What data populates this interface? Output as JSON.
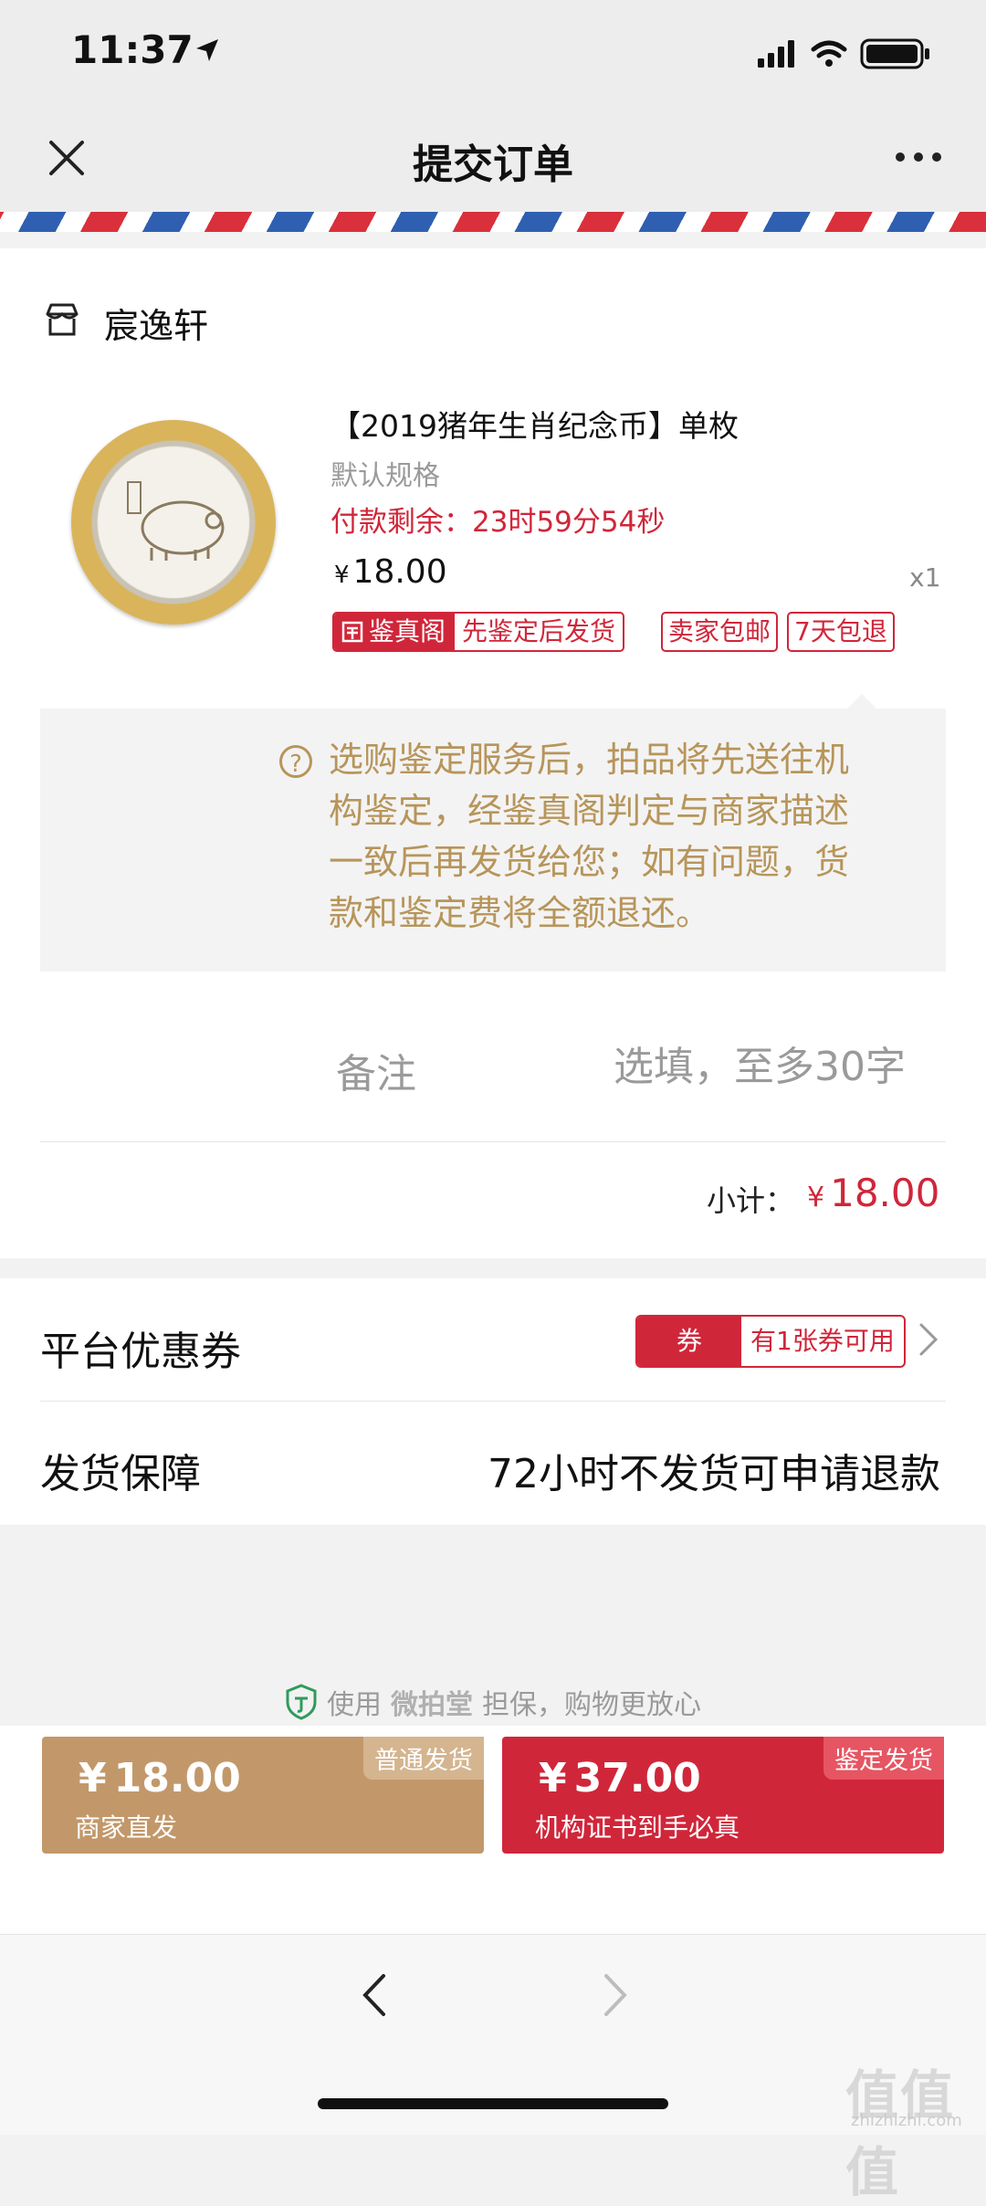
{
  "status_bar": {
    "time": "11:37"
  },
  "header": {
    "title": "提交订单"
  },
  "shop": {
    "name": "宸逸轩"
  },
  "product": {
    "title": "【2019猪年生肖纪念币】单枚",
    "spec": "默认规格",
    "countdown": "付款剩余：23时59分54秒",
    "currency": "¥",
    "price": "18.00",
    "quantity": "x1",
    "tags": {
      "auth_brand": "鉴真阁",
      "auth_desc": "先鉴定后发货",
      "free_shipping": "卖家包邮",
      "return_policy": "7天包退"
    }
  },
  "info": {
    "icon": "?",
    "text": "选购鉴定服务后，拍品将先送往机构鉴定，经鉴真阁判定与商家描述一致后再发货给您；如有问题，货款和鉴定费将全额退还。"
  },
  "remark": {
    "label": "备注",
    "placeholder": "选填，至多30字"
  },
  "subtotal": {
    "label": "小计：",
    "currency": "¥",
    "value": "18.00"
  },
  "coupon": {
    "label": "平台优惠券",
    "badge_left": "券",
    "badge_right": "有1张券可用"
  },
  "guarantee": {
    "label": "发货保障",
    "value": "72小时不发货可申请退款"
  },
  "assurance": {
    "prefix": "使用",
    "brand": "微拍堂",
    "suffix": "担保，购物更放心"
  },
  "actions": {
    "normal": {
      "currency": "¥",
      "price": "18.00",
      "sub": "商家直发",
      "badge": "普通发货"
    },
    "appraise": {
      "currency": "¥",
      "price": "37.00",
      "sub": "机构证书到手必真",
      "badge": "鉴定发货"
    }
  },
  "watermark": {
    "main": "值值值",
    "sub": "zhizhizhi.com"
  },
  "colors": {
    "accent_red": "#d0263a",
    "gold": "#c2986a",
    "info_text": "#b7955a"
  }
}
